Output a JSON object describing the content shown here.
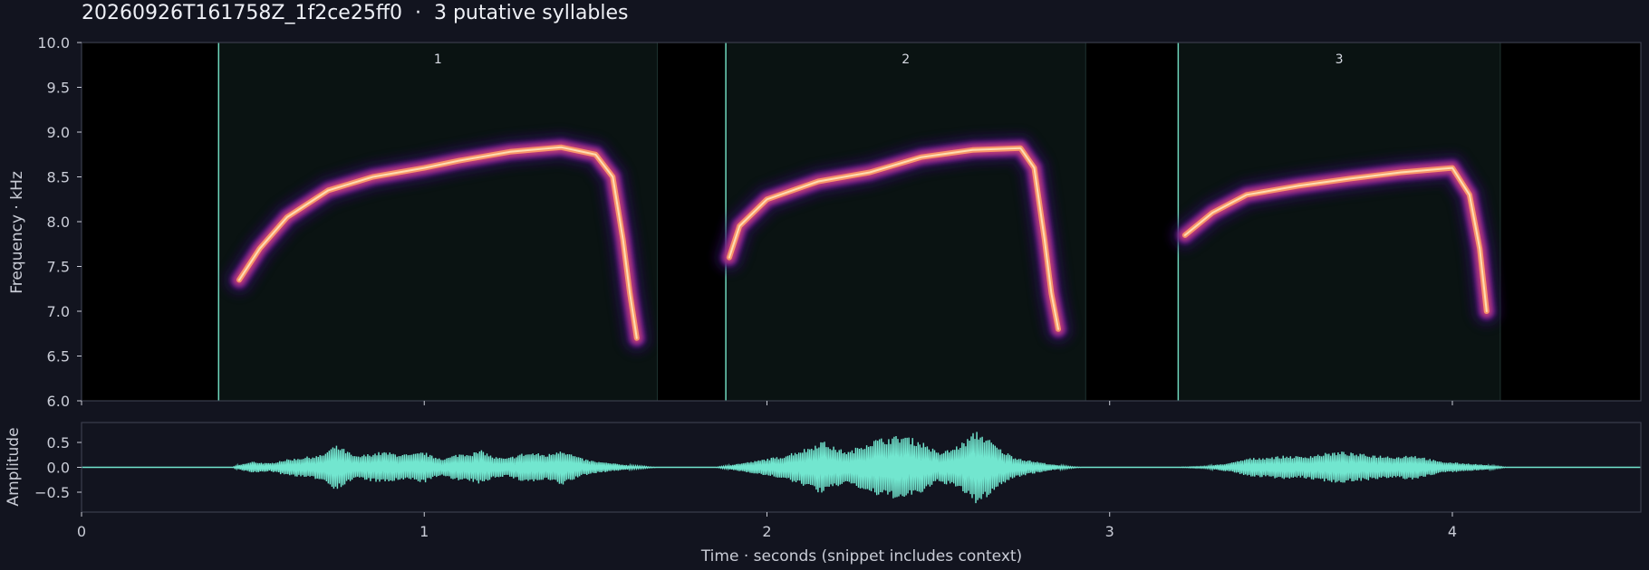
{
  "title": "20260926T161758Z_1f2ce25ff0  ·  3 putative syllables",
  "colors": {
    "background": "#12141f",
    "plot_background": "#000000",
    "syllable_shading": "#0a1312",
    "boundary_line": "#6fd7bd",
    "waveform": "#72e6cf",
    "spine": "#3a3e4c",
    "text": "#c9ccd6",
    "colormap": "magma"
  },
  "chart_data": [
    {
      "type": "heatmap",
      "name": "spectrogram",
      "title": "",
      "xlabel": "",
      "ylabel": "Frequency · kHz",
      "xlim": [
        0,
        4.55
      ],
      "ylim": [
        6.0,
        10.0
      ],
      "yticks": [
        "6.0",
        "6.5",
        "7.0",
        "7.5",
        "8.0",
        "8.5",
        "9.0",
        "9.5",
        "10.0"
      ],
      "xtick_positions": [
        0,
        1,
        2,
        3,
        4
      ],
      "show_xtick_labels": false,
      "syllables": [
        {
          "label": "1",
          "start": 0.4,
          "end": 1.68
        },
        {
          "label": "2",
          "start": 1.88,
          "end": 2.93
        },
        {
          "label": "3",
          "start": 3.2,
          "end": 4.14
        }
      ],
      "traces": [
        {
          "syllable": "1",
          "points": [
            [
              0.46,
              7.35
            ],
            [
              0.52,
              7.7
            ],
            [
              0.6,
              8.05
            ],
            [
              0.72,
              8.35
            ],
            [
              0.85,
              8.5
            ],
            [
              1.0,
              8.6
            ],
            [
              1.1,
              8.68
            ],
            [
              1.25,
              8.78
            ],
            [
              1.4,
              8.83
            ],
            [
              1.5,
              8.75
            ],
            [
              1.55,
              8.5
            ],
            [
              1.58,
              7.8
            ],
            [
              1.6,
              7.2
            ],
            [
              1.62,
              6.7
            ]
          ]
        },
        {
          "syllable": "2",
          "points": [
            [
              1.89,
              7.6
            ],
            [
              1.92,
              7.95
            ],
            [
              2.0,
              8.25
            ],
            [
              2.15,
              8.45
            ],
            [
              2.3,
              8.55
            ],
            [
              2.45,
              8.72
            ],
            [
              2.6,
              8.8
            ],
            [
              2.74,
              8.82
            ],
            [
              2.78,
              8.6
            ],
            [
              2.81,
              7.8
            ],
            [
              2.83,
              7.2
            ],
            [
              2.85,
              6.8
            ]
          ]
        },
        {
          "syllable": "3",
          "points": [
            [
              3.22,
              7.85
            ],
            [
              3.3,
              8.1
            ],
            [
              3.4,
              8.3
            ],
            [
              3.55,
              8.4
            ],
            [
              3.7,
              8.48
            ],
            [
              3.85,
              8.55
            ],
            [
              4.0,
              8.6
            ],
            [
              4.05,
              8.3
            ],
            [
              4.08,
              7.7
            ],
            [
              4.1,
              7.0
            ]
          ]
        }
      ]
    },
    {
      "type": "line",
      "name": "waveform",
      "title": "",
      "xlabel": "Time · seconds (snippet includes context)",
      "ylabel": "Amplitude",
      "xlim": [
        0,
        4.55
      ],
      "ylim": [
        -0.9,
        0.9
      ],
      "xticks": [
        "0",
        "1",
        "2",
        "3",
        "4"
      ],
      "yticks": [
        "0.5",
        "0.0",
        "−0.5"
      ],
      "ytick_values": [
        0.5,
        0.0,
        -0.5
      ],
      "envelope": [
        [
          0.0,
          0.0
        ],
        [
          0.44,
          0.0
        ],
        [
          0.46,
          0.05
        ],
        [
          0.48,
          0.08
        ],
        [
          0.5,
          0.12
        ],
        [
          0.52,
          0.1
        ],
        [
          0.55,
          0.08
        ],
        [
          0.58,
          0.14
        ],
        [
          0.6,
          0.16
        ],
        [
          0.64,
          0.2
        ],
        [
          0.66,
          0.22
        ],
        [
          0.7,
          0.25
        ],
        [
          0.72,
          0.35
        ],
        [
          0.74,
          0.45
        ],
        [
          0.76,
          0.4
        ],
        [
          0.8,
          0.22
        ],
        [
          0.84,
          0.28
        ],
        [
          0.88,
          0.32
        ],
        [
          0.92,
          0.28
        ],
        [
          0.96,
          0.26
        ],
        [
          1.0,
          0.32
        ],
        [
          1.02,
          0.24
        ],
        [
          1.06,
          0.18
        ],
        [
          1.1,
          0.28
        ],
        [
          1.14,
          0.3
        ],
        [
          1.17,
          0.35
        ],
        [
          1.2,
          0.22
        ],
        [
          1.24,
          0.18
        ],
        [
          1.28,
          0.28
        ],
        [
          1.32,
          0.3
        ],
        [
          1.36,
          0.26
        ],
        [
          1.4,
          0.38
        ],
        [
          1.42,
          0.3
        ],
        [
          1.46,
          0.18
        ],
        [
          1.5,
          0.12
        ],
        [
          1.55,
          0.08
        ],
        [
          1.6,
          0.04
        ],
        [
          1.64,
          0.02
        ],
        [
          1.68,
          0.0
        ],
        [
          1.85,
          0.0
        ],
        [
          1.88,
          0.03
        ],
        [
          1.92,
          0.08
        ],
        [
          1.96,
          0.12
        ],
        [
          2.0,
          0.18
        ],
        [
          2.04,
          0.22
        ],
        [
          2.08,
          0.32
        ],
        [
          2.12,
          0.4
        ],
        [
          2.16,
          0.55
        ],
        [
          2.2,
          0.4
        ],
        [
          2.24,
          0.32
        ],
        [
          2.28,
          0.48
        ],
        [
          2.32,
          0.58
        ],
        [
          2.36,
          0.62
        ],
        [
          2.4,
          0.66
        ],
        [
          2.44,
          0.55
        ],
        [
          2.46,
          0.5
        ],
        [
          2.5,
          0.3
        ],
        [
          2.54,
          0.38
        ],
        [
          2.58,
          0.55
        ],
        [
          2.61,
          0.75
        ],
        [
          2.64,
          0.62
        ],
        [
          2.68,
          0.38
        ],
        [
          2.72,
          0.22
        ],
        [
          2.76,
          0.15
        ],
        [
          2.8,
          0.1
        ],
        [
          2.84,
          0.05
        ],
        [
          2.88,
          0.02
        ],
        [
          2.92,
          0.0
        ],
        [
          3.2,
          0.0
        ],
        [
          3.28,
          0.02
        ],
        [
          3.32,
          0.06
        ],
        [
          3.36,
          0.1
        ],
        [
          3.4,
          0.18
        ],
        [
          3.44,
          0.2
        ],
        [
          3.48,
          0.22
        ],
        [
          3.52,
          0.24
        ],
        [
          3.56,
          0.22
        ],
        [
          3.6,
          0.26
        ],
        [
          3.64,
          0.3
        ],
        [
          3.68,
          0.32
        ],
        [
          3.72,
          0.28
        ],
        [
          3.76,
          0.26
        ],
        [
          3.8,
          0.24
        ],
        [
          3.84,
          0.22
        ],
        [
          3.88,
          0.26
        ],
        [
          3.92,
          0.2
        ],
        [
          3.96,
          0.12
        ],
        [
          4.0,
          0.1
        ],
        [
          4.04,
          0.08
        ],
        [
          4.08,
          0.06
        ],
        [
          4.12,
          0.03
        ],
        [
          4.16,
          0.0
        ],
        [
          4.55,
          0.0
        ]
      ]
    }
  ]
}
